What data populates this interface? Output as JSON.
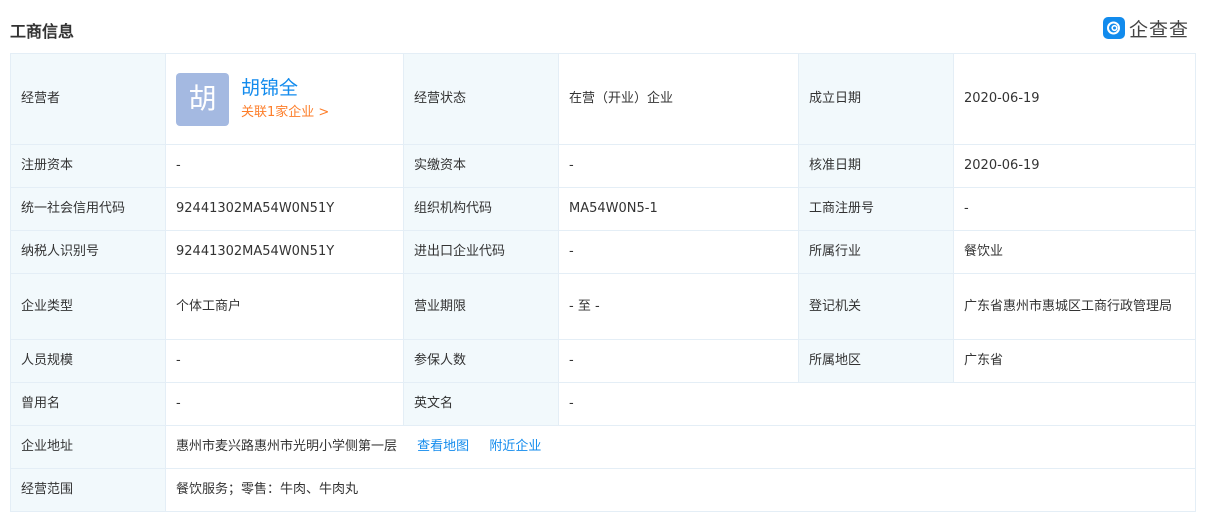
{
  "header": {
    "title": "工商信息",
    "brand": "企查查"
  },
  "rep": {
    "label": "经营者",
    "avatar_char": "胡",
    "name": "胡锦全",
    "link": "关联1家企业 >"
  },
  "rows": {
    "status_label": "经营状态",
    "status_value": "在营（开业）企业",
    "established_label": "成立日期",
    "established_value": "2020-06-19",
    "reg_capital_label": "注册资本",
    "reg_capital_value": "-",
    "paid_capital_label": "实缴资本",
    "paid_capital_value": "-",
    "approval_label": "核准日期",
    "approval_value": "2020-06-19",
    "credit_code_label": "统一社会信用代码",
    "credit_code_value": "92441302MA54W0N51Y",
    "org_code_label": "组织机构代码",
    "org_code_value": "MA54W0N5-1",
    "reg_no_label": "工商注册号",
    "reg_no_value": "-",
    "taxpayer_label": "纳税人识别号",
    "taxpayer_value": "92441302MA54W0N51Y",
    "import_export_label": "进出口企业代码",
    "import_export_value": "-",
    "industry_label": "所属行业",
    "industry_value": "餐饮业",
    "type_label": "企业类型",
    "type_value": "个体工商户",
    "term_label": "营业期限",
    "term_value": "- 至 -",
    "authority_label": "登记机关",
    "authority_value": "广东省惠州市惠城区工商行政管理局",
    "staff_label": "人员规模",
    "staff_value": "-",
    "insured_label": "参保人数",
    "insured_value": "-",
    "region_label": "所属地区",
    "region_value": "广东省",
    "former_name_label": "曾用名",
    "former_name_value": "-",
    "english_name_label": "英文名",
    "english_name_value": "-",
    "address_label": "企业地址",
    "address_value": "惠州市麦兴路惠州市光明小学侧第一层",
    "map_link": "查看地图",
    "nearby_link": "附近企业",
    "scope_label": "经营范围",
    "scope_value": "餐饮服务；零售：牛肉、牛肉丸"
  }
}
